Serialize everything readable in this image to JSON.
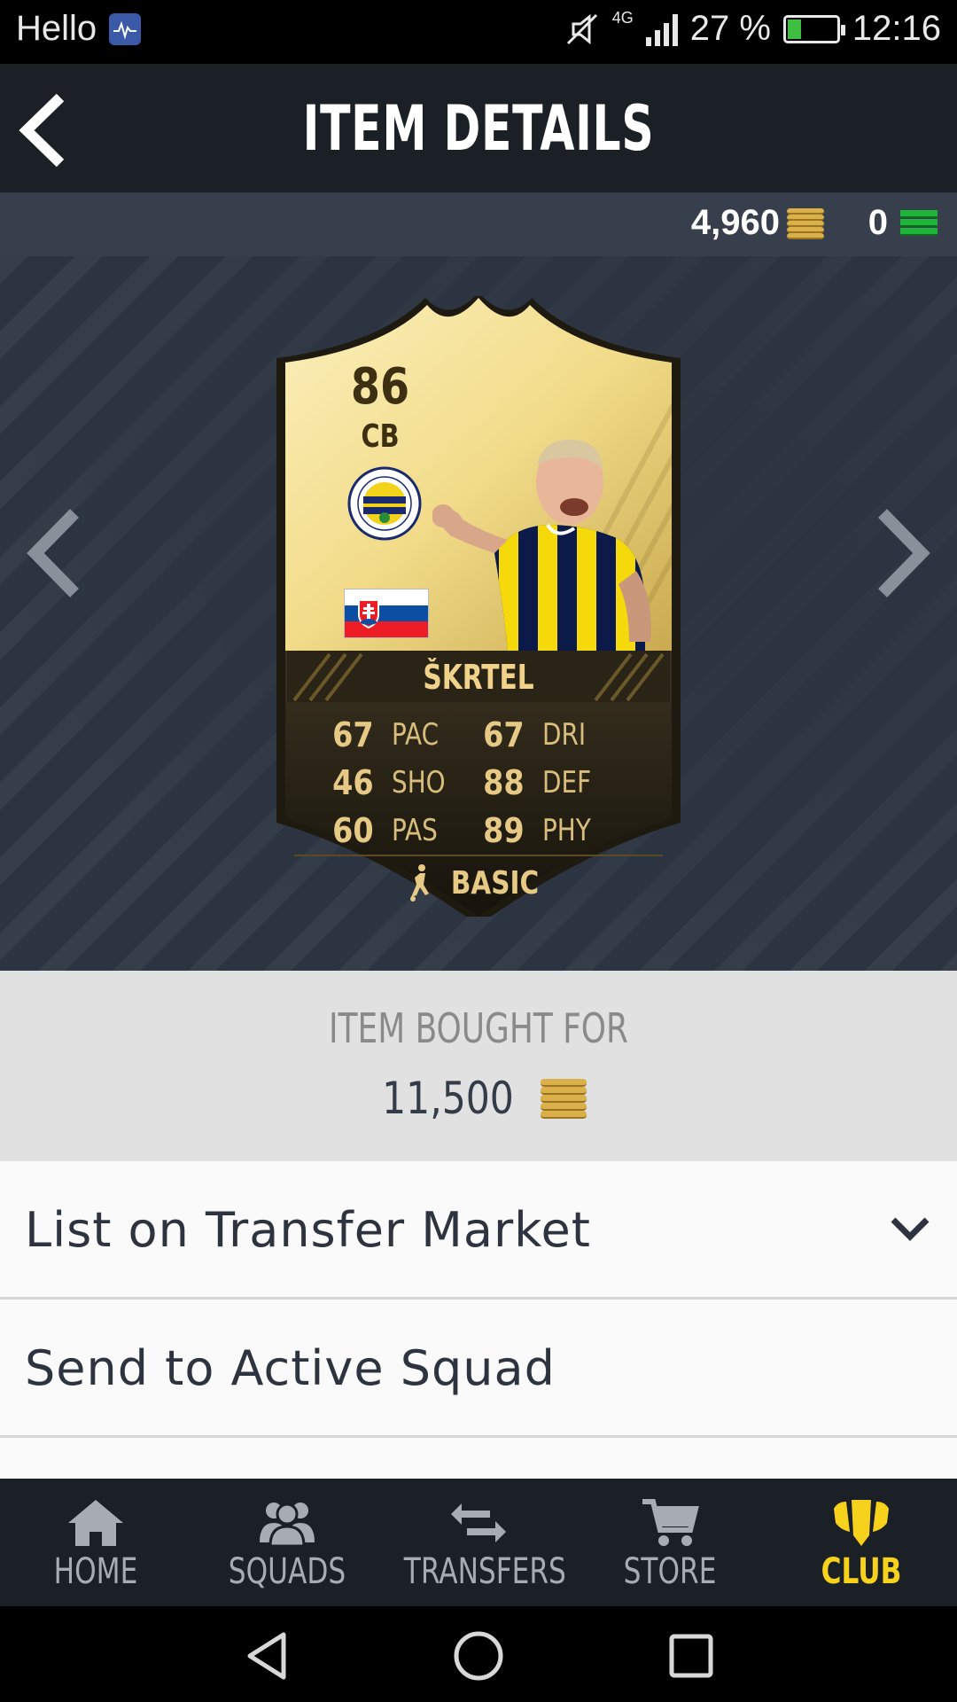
{
  "status_bar": {
    "carrier": "Hello",
    "network": "4G",
    "battery": "27 %",
    "time": "12:16"
  },
  "header": {
    "title": "ITEM DETAILS"
  },
  "currency": {
    "coins": "4,960",
    "points": "0"
  },
  "card": {
    "rating": "86",
    "position": "CB",
    "name": "ŠKRTEL",
    "stats": [
      {
        "left_value": "67",
        "left_label": "PAC",
        "right_value": "67",
        "right_label": "DRI"
      },
      {
        "left_value": "46",
        "left_label": "SHO",
        "right_value": "88",
        "right_label": "DEF"
      },
      {
        "left_value": "60",
        "left_label": "PAS",
        "right_value": "89",
        "right_label": "PHY"
      }
    ],
    "chemistry_style": "BASIC",
    "colors": {
      "gold_light": "#f8ecb0",
      "gold_dark": "#c9a94e",
      "card_dark": "#2a2416"
    }
  },
  "bought": {
    "label": "ITEM BOUGHT FOR",
    "price": "11,500"
  },
  "actions": [
    {
      "label": "List on Transfer Market",
      "icon": "chevron-down-icon"
    },
    {
      "label": "Send to Active Squad"
    }
  ],
  "tabs": [
    {
      "label": "HOME",
      "icon": "home-icon",
      "active": false
    },
    {
      "label": "SQUADS",
      "icon": "squads-icon",
      "active": false
    },
    {
      "label": "TRANSFERS",
      "icon": "transfers-icon",
      "active": false
    },
    {
      "label": "STORE",
      "icon": "cart-icon",
      "active": false
    },
    {
      "label": "CLUB",
      "icon": "club-icon",
      "active": true
    }
  ],
  "theme": {
    "accent": "#f6d21d",
    "header_bg": "#1b1f26",
    "currency_bg": "#363f4b"
  }
}
